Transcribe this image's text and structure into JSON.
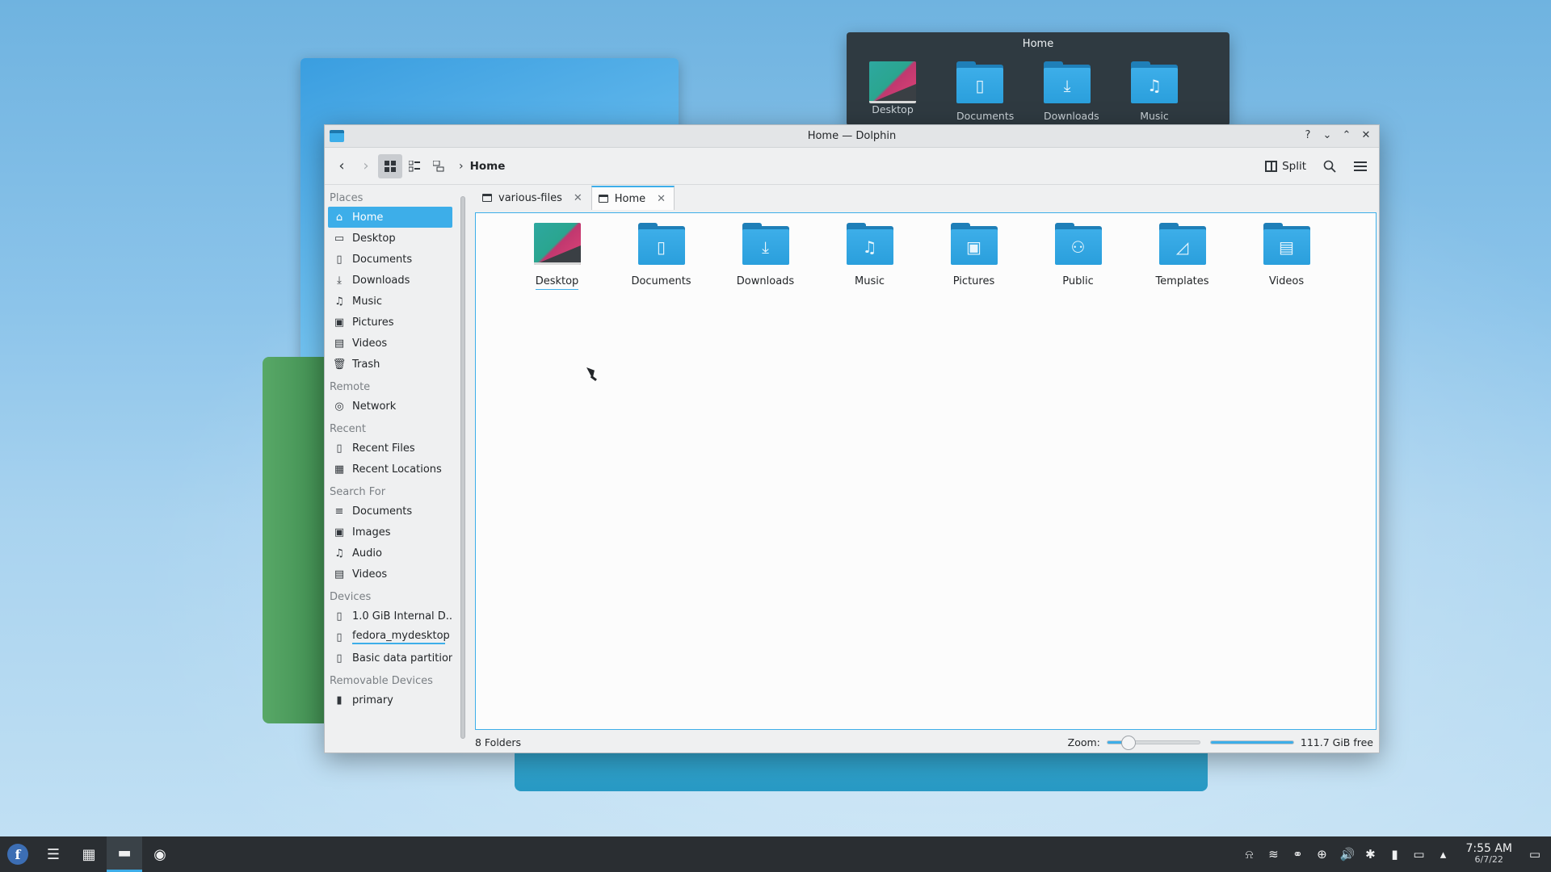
{
  "overview": {
    "title": "Home",
    "items": [
      "Desktop",
      "Documents",
      "Downloads",
      "Music"
    ]
  },
  "window": {
    "title": "Home — Dolphin",
    "controls": [
      "?",
      "⌄",
      "⌃",
      "✕"
    ]
  },
  "toolbar": {
    "back_icon": "back-arrow-icon",
    "forward_icon": "forward-arrow-icon",
    "breadcrumb": "Home",
    "split_label": "Split"
  },
  "sidebar": {
    "sections": [
      {
        "title": "Places",
        "items": [
          {
            "label": "Home",
            "icon": "⌂",
            "selected": true
          },
          {
            "label": "Desktop",
            "icon": "▭"
          },
          {
            "label": "Documents",
            "icon": "▯"
          },
          {
            "label": "Downloads",
            "icon": "⤓"
          },
          {
            "label": "Music",
            "icon": "♫"
          },
          {
            "label": "Pictures",
            "icon": "▣"
          },
          {
            "label": "Videos",
            "icon": "▤"
          },
          {
            "label": "Trash",
            "icon": "🗑"
          }
        ]
      },
      {
        "title": "Remote",
        "items": [
          {
            "label": "Network",
            "icon": "◎"
          }
        ]
      },
      {
        "title": "Recent",
        "items": [
          {
            "label": "Recent Files",
            "icon": "▯"
          },
          {
            "label": "Recent Locations",
            "icon": "▦"
          }
        ]
      },
      {
        "title": "Search For",
        "items": [
          {
            "label": "Documents",
            "icon": "≡"
          },
          {
            "label": "Images",
            "icon": "▣"
          },
          {
            "label": "Audio",
            "icon": "♫"
          },
          {
            "label": "Videos",
            "icon": "▤"
          }
        ]
      },
      {
        "title": "Devices",
        "items": [
          {
            "label": "1.0 GiB Internal D...",
            "icon": "▯"
          },
          {
            "label": "fedora_mydesktop",
            "icon": "▯",
            "capacity": 0.95
          },
          {
            "label": "Basic data partition",
            "icon": "▯"
          }
        ]
      },
      {
        "title": "Removable Devices",
        "items": [
          {
            "label": "primary",
            "icon": "▮"
          }
        ]
      }
    ]
  },
  "tabs": [
    {
      "label": "various-files",
      "active": false
    },
    {
      "label": "Home",
      "active": true
    }
  ],
  "folders": [
    {
      "label": "Desktop",
      "type": "desktop",
      "glyph": ""
    },
    {
      "label": "Documents",
      "type": "folder",
      "glyph": "▯"
    },
    {
      "label": "Downloads",
      "type": "folder",
      "glyph": "⤓"
    },
    {
      "label": "Music",
      "type": "folder",
      "glyph": "♫"
    },
    {
      "label": "Pictures",
      "type": "folder",
      "glyph": "▣"
    },
    {
      "label": "Public",
      "type": "folder",
      "glyph": "⚇"
    },
    {
      "label": "Templates",
      "type": "folder",
      "glyph": "◿"
    },
    {
      "label": "Videos",
      "type": "folder",
      "glyph": "▤"
    }
  ],
  "status": {
    "count": "8 Folders",
    "zoom_label": "Zoom:",
    "zoom_fraction": 0.23,
    "free_label": "111.7 GiB free",
    "used_fraction": 1.0
  },
  "taskbar": {
    "time": "7:55 AM",
    "date": "6/7/22"
  }
}
